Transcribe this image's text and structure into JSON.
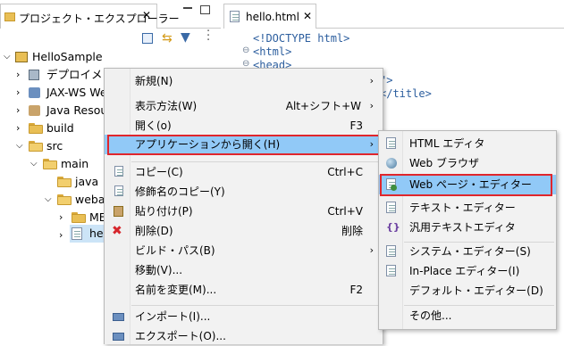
{
  "explorer": {
    "tab_label": "プロジェクト・エクスプローラー",
    "tree": [
      {
        "label": "HelloSample",
        "type": "project"
      },
      {
        "label": "デプロイメント記",
        "type": "node"
      },
      {
        "label": "JAX-WS Web",
        "type": "node"
      },
      {
        "label": "Java Resour",
        "type": "node"
      },
      {
        "label": "build",
        "type": "folder"
      },
      {
        "label": "src",
        "type": "folder"
      },
      {
        "label": "main",
        "type": "folder"
      },
      {
        "label": "java",
        "type": "folder"
      },
      {
        "label": "webap",
        "type": "folder"
      },
      {
        "label": "ME",
        "type": "folder"
      },
      {
        "label": "WE",
        "type": "folder"
      },
      {
        "label": "hel",
        "type": "file"
      }
    ]
  },
  "editor": {
    "tab_label": "hello.html",
    "lines": [
      "<!DOCTYPE html>",
      "<html>",
      "<head>",
      "\">",
      "</title>"
    ]
  },
  "context_menu": {
    "items": [
      {
        "label": "新規(N)",
        "shortcut": "",
        "submenu": true
      },
      {
        "label": "表示方法(W)",
        "shortcut": "Alt+シフト+W",
        "submenu": true
      },
      {
        "label": "開く(o)",
        "shortcut": "F3",
        "submenu": false
      },
      {
        "label": "アプリケーションから開く(H)",
        "shortcut": "",
        "submenu": true
      },
      {
        "label": "コピー(C)",
        "shortcut": "Ctrl+C",
        "submenu": false
      },
      {
        "label": "修飾名のコピー(Y)",
        "shortcut": "",
        "submenu": false
      },
      {
        "label": "貼り付け(P)",
        "shortcut": "Ctrl+V",
        "submenu": false
      },
      {
        "label": "削除(D)",
        "shortcut": "削除",
        "submenu": false
      },
      {
        "label": "ビルド・パス(B)",
        "shortcut": "",
        "submenu": true
      },
      {
        "label": "移動(V)...",
        "shortcut": "",
        "submenu": false
      },
      {
        "label": "名前を変更(M)...",
        "shortcut": "F2",
        "submenu": false
      },
      {
        "label": "インポート(I)...",
        "shortcut": "",
        "submenu": false
      },
      {
        "label": "エクスポート(O)...",
        "shortcut": "",
        "submenu": false
      }
    ]
  },
  "submenu": {
    "items": [
      {
        "label": "HTML エディタ"
      },
      {
        "label": "Web ブラウザ"
      },
      {
        "label": "Web ページ・エディター"
      },
      {
        "label": "テキスト・エディター"
      },
      {
        "label": "汎用テキストエディタ"
      },
      {
        "label": "システム・エディター(S)"
      },
      {
        "label": "In-Place エディター(I)"
      },
      {
        "label": "デフォルト・エディター(D)"
      },
      {
        "label": "その他..."
      }
    ]
  },
  "colors": {
    "highlight": "#91c9f7",
    "annotation_box": "#e0262c"
  }
}
